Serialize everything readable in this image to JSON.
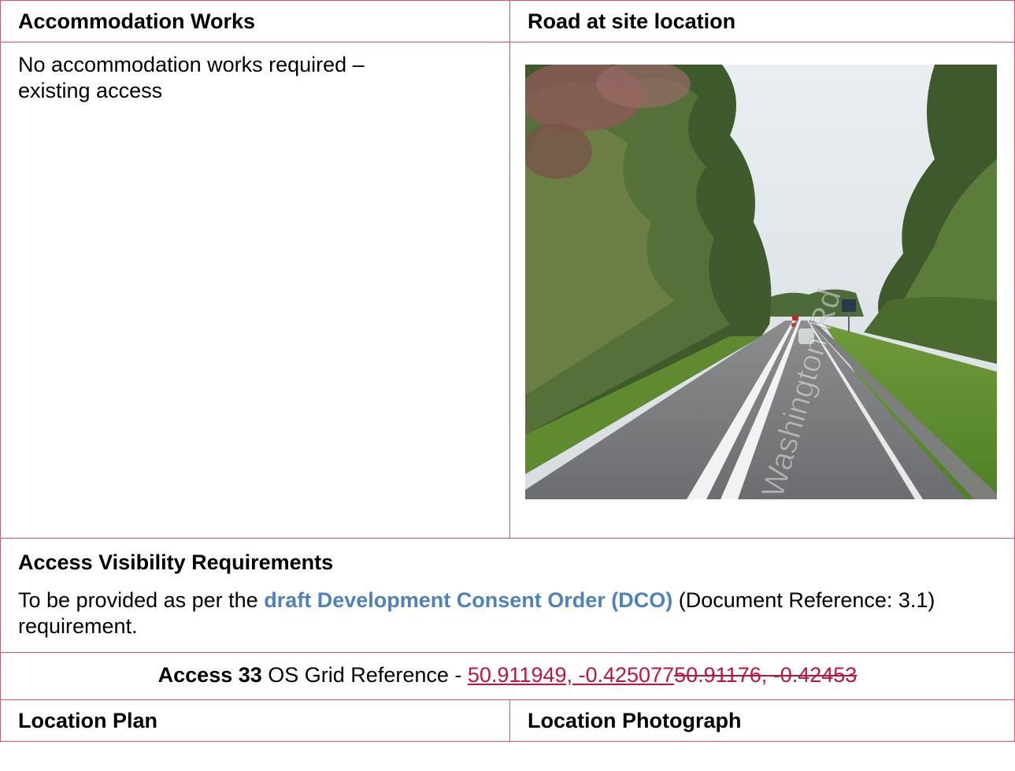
{
  "accommodation": {
    "header": "Accommodation Works",
    "text_line1": "No accommodation works required –",
    "text_line2": "existing access"
  },
  "road": {
    "header": "Road at site location",
    "photo_road_label": "Washington Rd"
  },
  "visibility": {
    "title": "Access Visibility Requirements",
    "text_before": "To be provided as per the ",
    "link": "draft Development Consent Order (DCO)",
    "text_after": " (Document Reference: 3.1) requirement."
  },
  "grid": {
    "access_label": "Access 33",
    "ref_label": " OS Grid Reference - ",
    "inserted": "50.911949, -0.425077",
    "deleted": "50.91176, -0.42453 "
  },
  "bottom": {
    "plan_header": "Location Plan",
    "photo_header": "Location Photograph"
  },
  "colors": {
    "border": "#e0556e",
    "link": "#4f81bd",
    "revision": "#c0143c"
  }
}
